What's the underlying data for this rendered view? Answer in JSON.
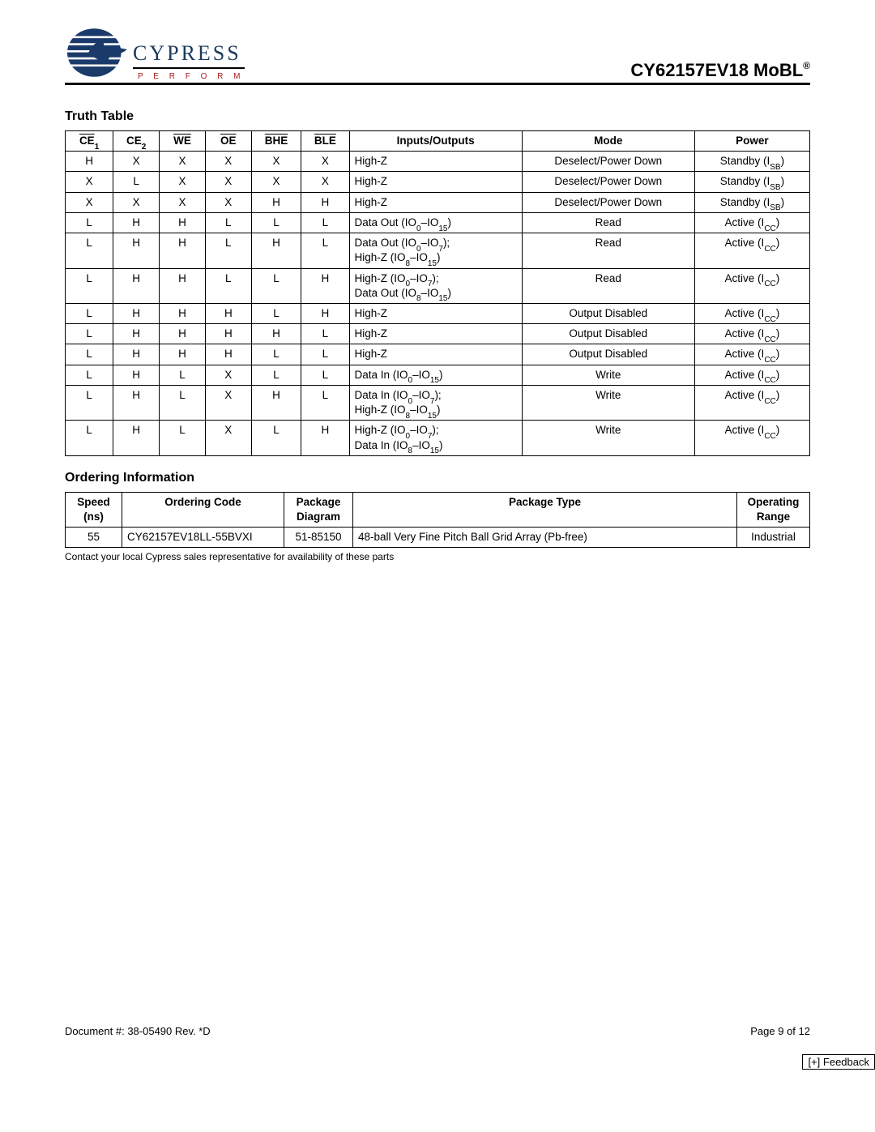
{
  "header": {
    "company": "CYPRESS",
    "tagline": "P E R F O R M",
    "part": "CY62157EV18 MoBL",
    "reg": "®"
  },
  "truth_table": {
    "title": "Truth Table",
    "headers": {
      "ce1": "CE",
      "ce1_sub": "1",
      "ce2": "CE",
      "ce2_sub": "2",
      "we": "WE",
      "oe": "OE",
      "bhe": "BHE",
      "ble": "BLE",
      "io": "Inputs/Outputs",
      "mode": "Mode",
      "power": "Power"
    },
    "rows": [
      {
        "ce1": "H",
        "ce2": "X",
        "we": "X",
        "oe": "X",
        "bhe": "X",
        "ble": "X",
        "io": "High-Z",
        "mode": "Deselect/Power Down",
        "pow": "Standby (I",
        "pow_sub": "SB",
        "pow_tail": ")"
      },
      {
        "ce1": "X",
        "ce2": "L",
        "we": "X",
        "oe": "X",
        "bhe": "X",
        "ble": "X",
        "io": "High-Z",
        "mode": "Deselect/Power Down",
        "pow": "Standby (I",
        "pow_sub": "SB",
        "pow_tail": ")"
      },
      {
        "ce1": "X",
        "ce2": "X",
        "we": "X",
        "oe": "X",
        "bhe": "H",
        "ble": "H",
        "io": "High-Z",
        "mode": "Deselect/Power Down",
        "pow": "Standby (I",
        "pow_sub": "SB",
        "pow_tail": ")"
      },
      {
        "ce1": "L",
        "ce2": "H",
        "we": "H",
        "oe": "L",
        "bhe": "L",
        "ble": "L",
        "io_rich": "Data Out (IO<sub>0</sub>–IO<sub>15</sub>)",
        "mode": "Read",
        "pow": "Active (I",
        "pow_sub": "CC",
        "pow_tail": ")"
      },
      {
        "ce1": "L",
        "ce2": "H",
        "we": "H",
        "oe": "L",
        "bhe": "H",
        "ble": "L",
        "io_rich": "Data Out (IO<sub>0</sub>–IO<sub>7</sub>);<br>High-Z (IO<sub>8</sub>–IO<sub>15</sub>)",
        "mode": "Read",
        "pow": "Active (I",
        "pow_sub": "CC",
        "pow_tail": ")"
      },
      {
        "ce1": "L",
        "ce2": "H",
        "we": "H",
        "oe": "L",
        "bhe": "L",
        "ble": "H",
        "io_rich": "High-Z (IO<sub>0</sub>–IO<sub>7</sub>);<br>Data Out (IO<sub>8</sub>–IO<sub>15</sub>)",
        "mode": "Read",
        "pow": "Active (I",
        "pow_sub": "CC",
        "pow_tail": ")"
      },
      {
        "ce1": "L",
        "ce2": "H",
        "we": "H",
        "oe": "H",
        "bhe": "L",
        "ble": "H",
        "io": "High-Z",
        "mode": "Output Disabled",
        "pow": "Active (I",
        "pow_sub": "CC",
        "pow_tail": ")"
      },
      {
        "ce1": "L",
        "ce2": "H",
        "we": "H",
        "oe": "H",
        "bhe": "H",
        "ble": "L",
        "io": "High-Z",
        "mode": "Output Disabled",
        "pow": "Active (I",
        "pow_sub": "CC",
        "pow_tail": ")"
      },
      {
        "ce1": "L",
        "ce2": "H",
        "we": "H",
        "oe": "H",
        "bhe": "L",
        "ble": "L",
        "io": "High-Z",
        "mode": "Output Disabled",
        "pow": "Active (I",
        "pow_sub": "CC",
        "pow_tail": ")"
      },
      {
        "ce1": "L",
        "ce2": "H",
        "we": "L",
        "oe": "X",
        "bhe": "L",
        "ble": "L",
        "io_rich": "Data In (IO<sub>0</sub>–IO<sub>15</sub>)",
        "mode": "Write",
        "pow": "Active (I",
        "pow_sub": "CC",
        "pow_tail": ")"
      },
      {
        "ce1": "L",
        "ce2": "H",
        "we": "L",
        "oe": "X",
        "bhe": "H",
        "ble": "L",
        "io_rich": "Data In (IO<sub>0</sub>–IO<sub>7</sub>);<br>High-Z (IO<sub>8</sub>–IO<sub>15</sub>)",
        "mode": "Write",
        "pow": "Active (I",
        "pow_sub": "CC",
        "pow_tail": ")"
      },
      {
        "ce1": "L",
        "ce2": "H",
        "we": "L",
        "oe": "X",
        "bhe": "L",
        "ble": "H",
        "io_rich": "High-Z (IO<sub>0</sub>–IO<sub>7</sub>);<br>Data In (IO<sub>8</sub>–IO<sub>15</sub>)",
        "mode": "Write",
        "pow": "Active (I",
        "pow_sub": "CC",
        "pow_tail": ")"
      }
    ]
  },
  "ordering": {
    "title": "Ordering Information",
    "headers": {
      "speed": "Speed (ns)",
      "code": "Ordering Code",
      "pdiag": "Package Diagram",
      "ptype": "Package Type",
      "range": "Operating Range"
    },
    "rows": [
      {
        "speed": "55",
        "code": "CY62157EV18LL-55BVXI",
        "pdiag": "51-85150",
        "ptype": "48-ball Very Fine Pitch Ball Grid Array (Pb-free)",
        "range": "Industrial"
      }
    ],
    "note": "Contact your local Cypress sales representative for availability of these parts"
  },
  "footer": {
    "doc": "Document #: 38-05490 Rev. *D",
    "page": "Page 9 of 12",
    "feedback": "[+] Feedback"
  }
}
